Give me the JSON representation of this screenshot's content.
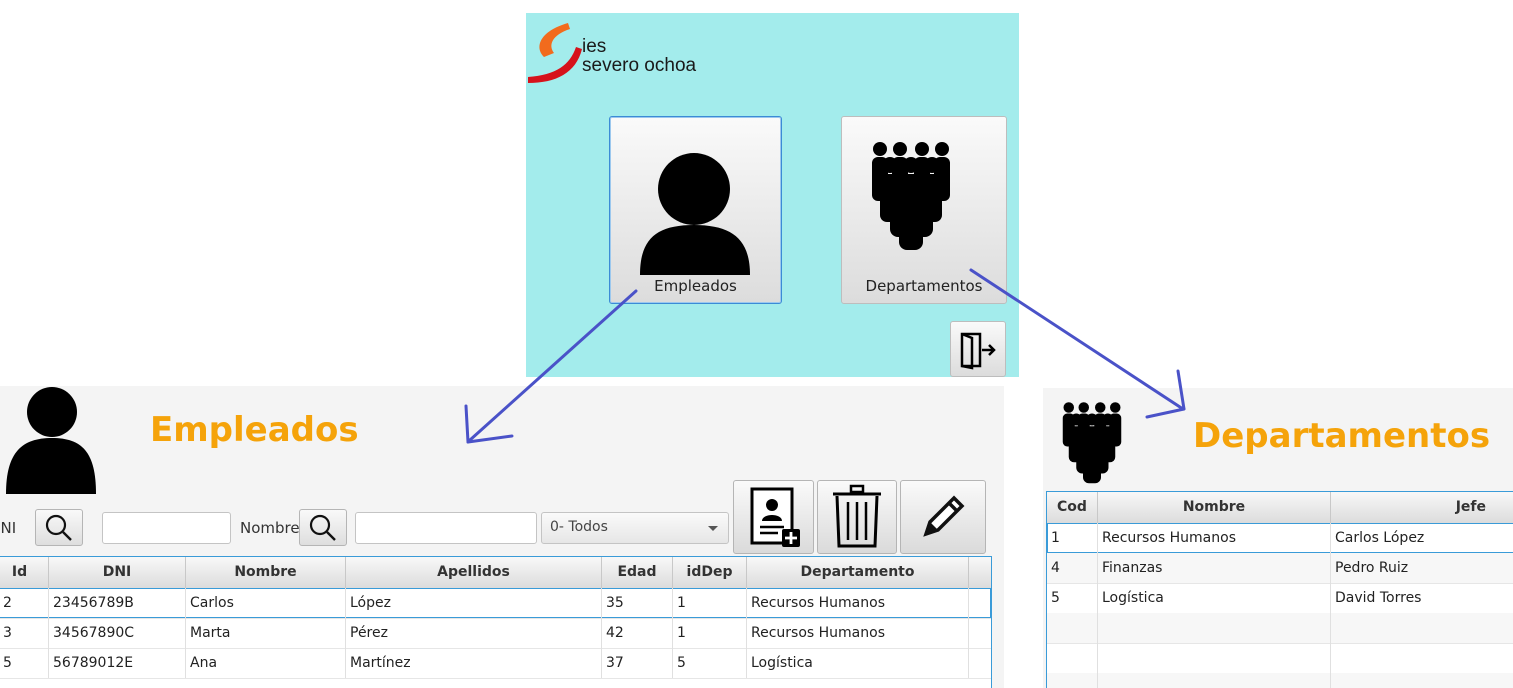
{
  "menu": {
    "logo_line1": "ies",
    "logo_line2": "severo ochoa",
    "employees_label": "Empleados",
    "departments_label": "Departamentos",
    "exit_icon": "exit-door-icon",
    "colors": {
      "background": "#a3ecec",
      "logo_orange": "#f26b1d",
      "logo_red": "#d6121b"
    }
  },
  "employees": {
    "title": "Empleados",
    "dni_label": "DNI",
    "name_label": "Nombre",
    "dni_value": "",
    "name_value": "",
    "filter_selected": "0- Todos",
    "columns": [
      "Id",
      "DNI",
      "Nombre",
      "Apellidos",
      "Edad",
      "idDep",
      "Departamento"
    ],
    "rows": [
      [
        "2",
        "23456789B",
        "Carlos",
        "López",
        "35",
        "1",
        "Recursos Humanos"
      ],
      [
        "3",
        "34567890C",
        "Marta",
        "Pérez",
        "42",
        "1",
        "Recursos Humanos"
      ],
      [
        "5",
        "56789012E",
        "Ana",
        "Martínez",
        "37",
        "5",
        "Logística"
      ]
    ],
    "title_color": "#f5a30a"
  },
  "departments": {
    "title": "Departamentos",
    "columns": [
      "Cod",
      "Nombre",
      "Jefe"
    ],
    "rows": [
      [
        "1",
        "Recursos Humanos",
        "Carlos López"
      ],
      [
        "4",
        "Finanzas",
        "Pedro Ruiz"
      ],
      [
        "5",
        "Logística",
        "David Torres"
      ]
    ]
  },
  "arrow_color": "#4a52c8"
}
